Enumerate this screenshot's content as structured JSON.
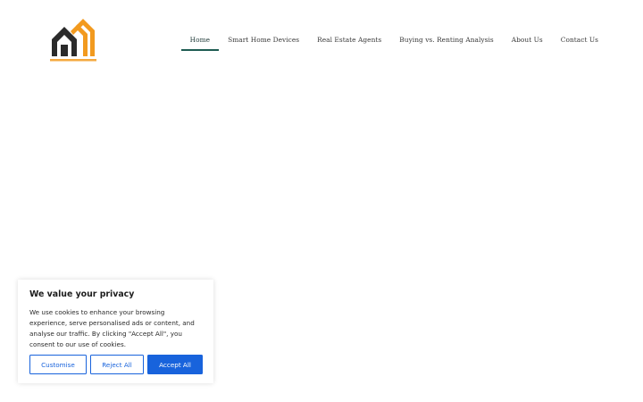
{
  "header": {
    "logo_icon": "house-logo-icon",
    "nav": [
      {
        "label": "Home",
        "active": true
      },
      {
        "label": "Smart Home Devices",
        "active": false
      },
      {
        "label": "Real Estate Agents",
        "active": false
      },
      {
        "label": "Buying vs. Renting Analysis",
        "active": false
      },
      {
        "label": "About Us",
        "active": false
      },
      {
        "label": "Contact Us",
        "active": false
      }
    ]
  },
  "cookie_banner": {
    "title": "We value your privacy",
    "text": "We use cookies to enhance your browsing experience, serve personalised ads or content, and analyse our traffic. By clicking \"Accept All\", you consent to our use of cookies.",
    "customise_label": "Customise",
    "reject_label": "Reject All",
    "accept_label": "Accept All"
  },
  "colors": {
    "accent": "#1863dc",
    "nav_active_underline": "#1e5c52",
    "logo_dark": "#2b2b2b",
    "logo_orange": "#f29a1f"
  }
}
